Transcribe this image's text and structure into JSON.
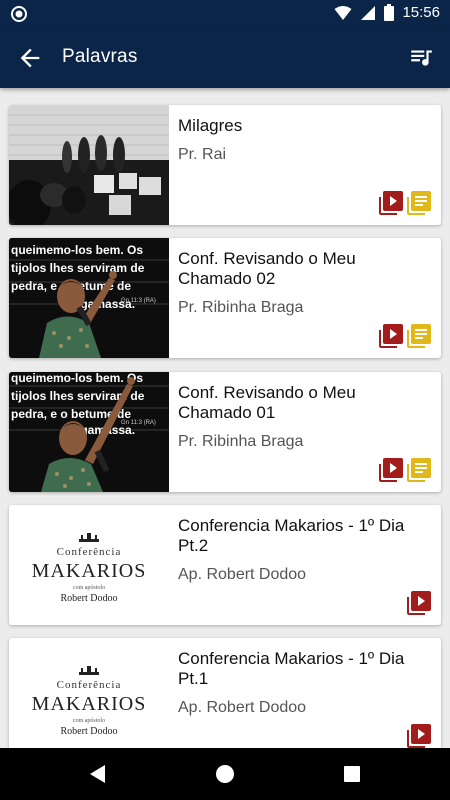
{
  "status_bar": {
    "time": "15:56"
  },
  "app_bar": {
    "title": "Palavras",
    "back_icon": "arrow-back-icon",
    "queue_icon": "queue-music-icon"
  },
  "colors": {
    "primary": "#0a2547",
    "video_icon": "#a31c1c",
    "text_icon": "#e0b818"
  },
  "items": [
    {
      "title": "Milagres",
      "speaker": "Pr. Rai",
      "has_video": true,
      "has_text": true
    },
    {
      "title": "Conf. Revisando o Meu Chamado 02",
      "speaker": "Pr. Ribinha Braga",
      "has_video": true,
      "has_text": true
    },
    {
      "title": "Conf. Revisando o Meu Chamado 01",
      "speaker": "Pr. Ribinha Braga",
      "has_video": true,
      "has_text": true
    },
    {
      "title": "Conferencia Makarios - 1º Dia Pt.2",
      "speaker": "Ap. Robert Dodoo",
      "has_video": true,
      "has_text": false
    },
    {
      "title": "Conferencia Makarios - 1º Dia Pt.1",
      "speaker": "Ap. Robert Dodoo",
      "has_video": true,
      "has_text": false
    }
  ],
  "thumb_text": {
    "slide_lines": [
      "queimemo-los bem. Os",
      "tijolos lhes serviram de",
      "pedra, e o betume de",
      "argamassa."
    ],
    "slide_ref": "Gn 11:3 (RA)",
    "makarios_top": "Conferência",
    "makarios_main": "MAKARIOS",
    "makarios_with": "com apóstolo",
    "makarios_name": "Robert Dodoo"
  }
}
